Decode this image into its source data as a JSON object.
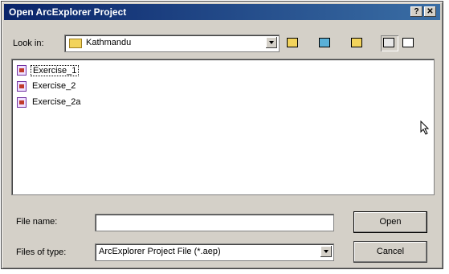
{
  "window": {
    "title": "Open ArcExplorer Project",
    "help_label": "?",
    "close_label": "✕"
  },
  "look_in": {
    "label": "Look in:",
    "value": "Kathmandu"
  },
  "toolbar": [
    {
      "name": "up-one-level-icon"
    },
    {
      "name": "desktop-icon"
    },
    {
      "name": "new-folder-icon"
    },
    {
      "name": "list-view-icon"
    },
    {
      "name": "details-view-icon"
    }
  ],
  "files": [
    {
      "name": "Exercise_1",
      "selected": true
    },
    {
      "name": "Exercise_2",
      "selected": false
    },
    {
      "name": "Exercise_2a",
      "selected": false
    }
  ],
  "file_name": {
    "label": "File name:",
    "value": ""
  },
  "file_type": {
    "label": "Files of type:",
    "value": "ArcExplorer Project File (*.aep)"
  },
  "buttons": {
    "open": "Open",
    "cancel": "Cancel"
  }
}
